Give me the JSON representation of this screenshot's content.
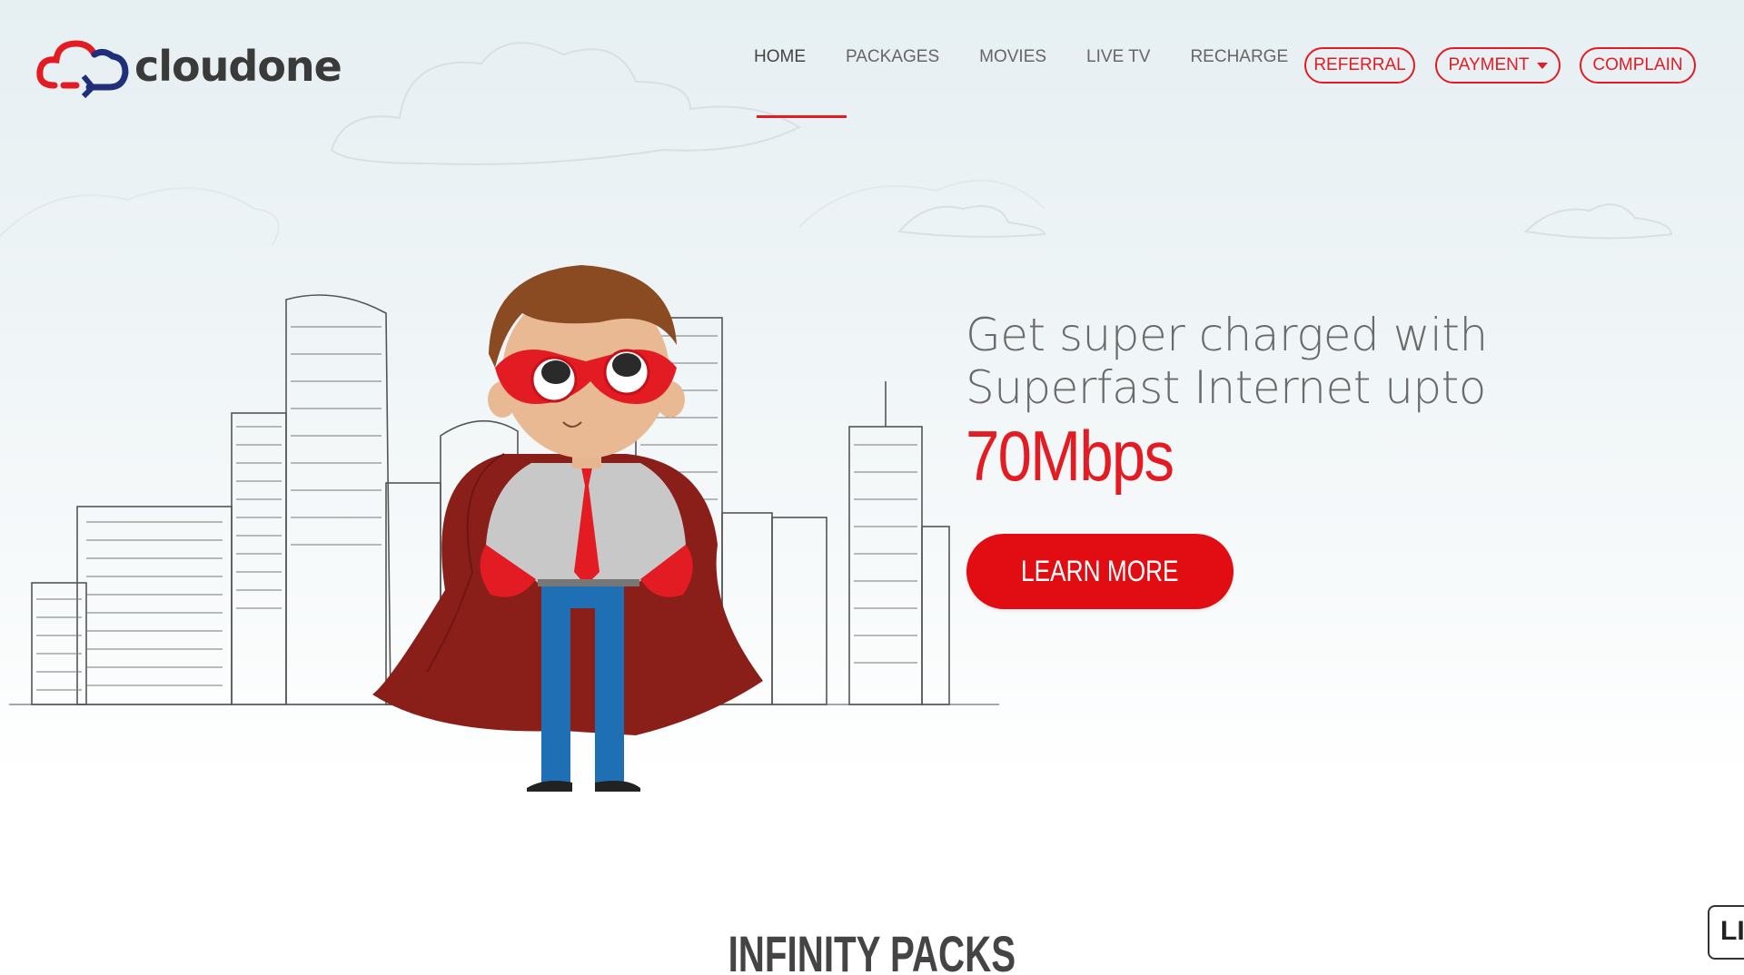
{
  "brand": {
    "name": "cloudone",
    "logo_icon": "cloud-icon"
  },
  "nav": {
    "items": [
      {
        "label": "HOME",
        "active": true
      },
      {
        "label": "PACKAGES"
      },
      {
        "label": "MOVIES"
      },
      {
        "label": "LIVE TV"
      },
      {
        "label": "RECHARGE"
      }
    ],
    "buttons": {
      "referral": "REFERRAL",
      "payment": "PAYMENT",
      "complain": "COMPLAIN"
    }
  },
  "hero": {
    "line1": "Get super charged with",
    "line2": "Superfast Internet upto",
    "speed": "70Mbps",
    "cta": "LEARN MORE",
    "illustration": "superhero-city-illustration"
  },
  "section": {
    "title": "INFINITY PACKS"
  },
  "side_tab": {
    "label": "LI"
  },
  "colors": {
    "accent": "#e31b23",
    "button": "#e10d12",
    "text": "#6a6a6a"
  }
}
